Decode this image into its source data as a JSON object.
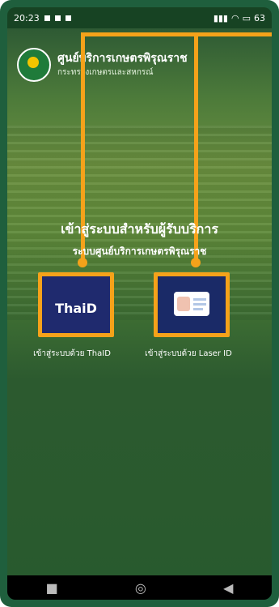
{
  "status_bar": {
    "time": "20:23",
    "battery": "63"
  },
  "header": {
    "title": "ศูนย์บริการเกษตรพิรุณราช",
    "subtitle": "กระทรวงเกษตรและสหกรณ์"
  },
  "hero": {
    "headline": "เข้าสู่ระบบสำหรับผู้รับบริการ",
    "subheadline": "ระบบศูนย์บริการเกษตรพิรุณราช"
  },
  "login_options": [
    {
      "logo_text": "ThaiD",
      "label": "เข้าสู่ระบบด้วย ThaID",
      "icon": "thaid-logo-icon"
    },
    {
      "label": "เข้าสู่ระบบด้วย Laser ID",
      "icon": "id-card-icon"
    }
  ],
  "colors": {
    "accent": "#f5a21a",
    "card_bg": "#1f2a6e",
    "frame": "#1f5f3d"
  },
  "nav_icons": [
    "square-icon",
    "circle-icon",
    "back-triangle-icon"
  ]
}
